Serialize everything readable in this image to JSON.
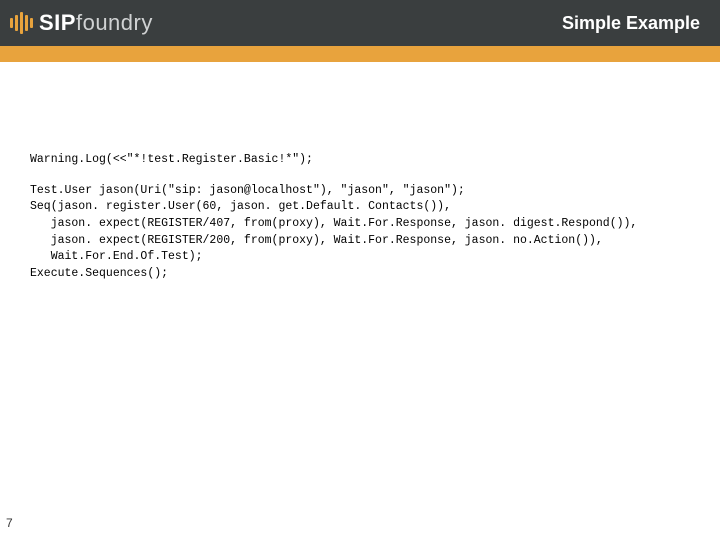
{
  "header": {
    "logo_sip": "SIP",
    "logo_foundry": "foundry",
    "title": "Simple Example"
  },
  "content": {
    "code_line1": "Warning.Log(<<\"*!test.Register.Basic!*\");",
    "code_block2": "Test.User jason(Uri(\"sip: jason@localhost\"), \"jason\", \"jason\");\nSeq(jason. register.User(60, jason. get.Default. Contacts()),\n   jason. expect(REGISTER/407, from(proxy), Wait.For.Response, jason. digest.Respond()),\n   jason. expect(REGISTER/200, from(proxy), Wait.For.Response, jason. no.Action()),\n   Wait.For.End.Of.Test);\nExecute.Sequences();"
  },
  "page_number": "7"
}
